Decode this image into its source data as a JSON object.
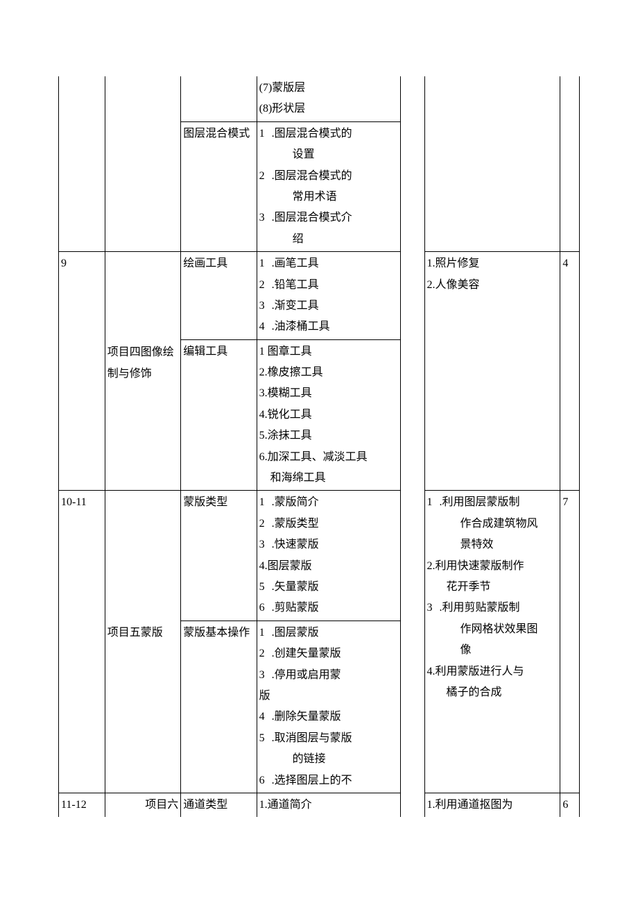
{
  "rows": [
    {
      "col1": "",
      "col2": "",
      "sub": [
        {
          "c3": "",
          "c4_pre_list": [
            "(7)蒙版层",
            "(8)形状层"
          ],
          "c4_list": []
        },
        {
          "c3": "图层混合模式",
          "c4_list": [
            {
              "n": "1",
              "t": "     .图层混合模式的",
              "indent": "设置"
            },
            {
              "n": "2",
              "t": "     .图层混合模式的",
              "indent": "常用术语"
            },
            {
              "n": "3",
              "t": "     .图层混合模式介",
              "indent": "绍"
            }
          ]
        }
      ],
      "c6": "",
      "c7": ""
    },
    {
      "col1": "9",
      "col2": "项目四图像绘制与修饰",
      "sub": [
        {
          "c3": "绘画工具",
          "c4_list": [
            {
              "n": "1",
              "t": "      .画笔工具"
            },
            {
              "n": "2",
              "t": "      .铅笔工具"
            },
            {
              "n": "3",
              "t": "      .渐变工具"
            },
            {
              "n": "4",
              "t": "      .油漆桶工具"
            }
          ]
        },
        {
          "c3": "编辑工具",
          "c4_plain": [
            "1 图章工具",
            "2.橡皮擦工具",
            "3.模糊工具",
            "4.锐化工具",
            "5.涂抹工具",
            "6.加深工具、减淡工具",
            "　和海绵工具"
          ]
        }
      ],
      "c6_list": [
        "1.照片修复",
        "2.人像美容"
      ],
      "c7": "4"
    },
    {
      "col1": "10-11",
      "col2": "项目五蒙版",
      "sub": [
        {
          "c3": "蒙版类型",
          "c4_list": [
            {
              "n": "1",
              "t": "      .蒙版简介"
            },
            {
              "n": "2",
              "t": "      .蒙版类型"
            },
            {
              "n": "3",
              "t": "      .快速蒙版"
            },
            {
              "plain": "4.图层蒙版"
            },
            {
              "n": "5",
              "t": "      .矢量蒙版"
            },
            {
              "n": "6",
              "t": "      .剪贴蒙版"
            }
          ]
        },
        {
          "c3": "蒙版基本操作",
          "c4_list": [
            {
              "n": "1",
              "t": "      .图层蒙版"
            },
            {
              "n": "2",
              "t": "      .创建矢量蒙版"
            },
            {
              "n": "3",
              "t": "      .停用或启用蒙"
            },
            {
              "plain": "版"
            },
            {
              "n": "4",
              "t": "      .删除矢量蒙版"
            },
            {
              "n": "5",
              "t": "      .取消图层与蒙版",
              "indent": "的链接"
            },
            {
              "n": "6",
              "t": "    .选择图层上的不"
            }
          ]
        }
      ],
      "c6_mixed": [
        {
          "n": "1",
          "t": "     .利用图层蒙版制",
          "indent": [
            "作合成建筑物风",
            "景特效"
          ]
        },
        {
          "plain": "2.利用快速蒙版制作"
        },
        {
          "indent_only": "花开季节"
        },
        {
          "n": "3",
          "t": "     .利用剪贴蒙版制",
          "indent": [
            "作网格状效果图",
            "像"
          ]
        },
        {
          "plain": "4.利用蒙版进行人与"
        },
        {
          "indent_only": "橘子的合成"
        }
      ],
      "c7": "7"
    },
    {
      "col1": "11-12",
      "col2": "项目六",
      "sub": [
        {
          "c3": "通道类型",
          "c4_plain": [
            "1.通道简介"
          ]
        }
      ],
      "c6_list": [
        "1.利用通道抠图为"
      ],
      "c7": "6"
    }
  ]
}
